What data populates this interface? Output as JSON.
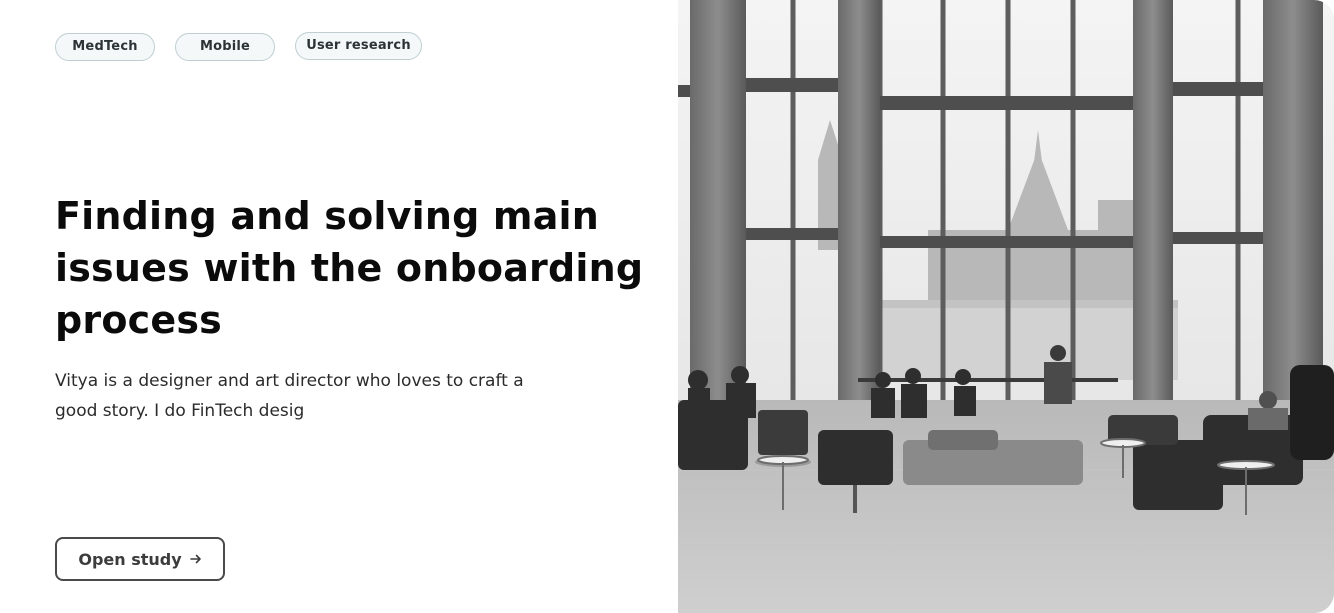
{
  "tags": [
    "MedTech",
    "Mobile",
    "User research"
  ],
  "title": "Finding and solving main issues with the onboarding process",
  "description": "Vitya is a designer and art director who loves to craft a good story. I do FinTech desig",
  "cta": {
    "label": "Open study",
    "icon": "arrow-right-icon"
  },
  "image": {
    "subject": "grayscale-atrium-photo"
  },
  "colors": {
    "tag_border": "#bfcfd1",
    "tag_bg": "#f4f8f9",
    "title": "#0b0b0b",
    "button_border": "#4a4a4a"
  }
}
